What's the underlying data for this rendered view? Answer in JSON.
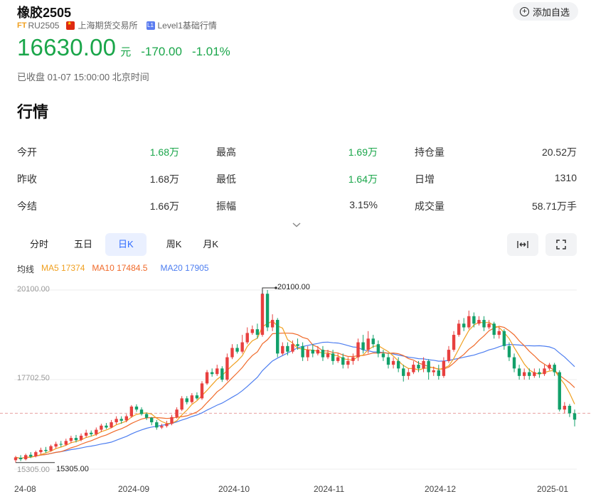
{
  "header": {
    "title": "橡胶2505",
    "exchange_tag": "FT",
    "code": "RU2505",
    "exchange": "上海期货交易所",
    "level_badge": "L1",
    "level": "Level1基础行情",
    "watch_label": "添加自选"
  },
  "quote": {
    "price": "16630.00",
    "unit": "元",
    "change": "-170.00",
    "change_pct": "-1.01%",
    "status": "已收盘 01-07 15:00:00 北京时间",
    "color": "#1aa64a"
  },
  "section_title": "行情",
  "stats": [
    [
      {
        "label": "今开",
        "value": "1.68万",
        "color": "green"
      },
      {
        "label": "最高",
        "value": "1.69万",
        "color": "green"
      },
      {
        "label": "持仓量",
        "value": "20.52万",
        "color": "dark"
      }
    ],
    [
      {
        "label": "昨收",
        "value": "1.68万",
        "color": "dark"
      },
      {
        "label": "最低",
        "value": "1.64万",
        "color": "green"
      },
      {
        "label": "日增",
        "value": "1310",
        "color": "dark"
      }
    ],
    [
      {
        "label": "今结",
        "value": "1.66万",
        "color": "dark"
      },
      {
        "label": "振幅",
        "value": "3.15%",
        "color": "dark"
      },
      {
        "label": "成交量",
        "value": "58.71万手",
        "color": "dark"
      }
    ]
  ],
  "expand_icon": "chevron-down-icon",
  "tabs": [
    {
      "label": "分时",
      "active": false
    },
    {
      "label": "五日",
      "active": false
    },
    {
      "label": "日K",
      "active": true
    },
    {
      "label": "周K",
      "active": false
    },
    {
      "label": "月K",
      "active": false
    }
  ],
  "tools": {
    "fit_icon": "fit-width-icon",
    "fullscreen_icon": "fullscreen-icon"
  },
  "legend": {
    "label": "均线",
    "ma5": "MA5 17374",
    "ma10": "MA10 17484.5",
    "ma20": "MA20 17905"
  },
  "colors": {
    "up": "#e8403f",
    "down": "#12a06a",
    "ma5": "#f0a020",
    "ma10": "#f06a2a",
    "ma20": "#4d7ef0",
    "ref": "#e8a0a0"
  },
  "chart_data": {
    "type": "candlestick",
    "y_ticks": [
      "20100.00",
      "17702.50",
      "15305.00"
    ],
    "x_ticks": [
      "24-08",
      "2024-09",
      "2024-10",
      "2024-11",
      "2024-12",
      "2025-01"
    ],
    "ylim": [
      15305,
      20100
    ],
    "max_label": "20100.00",
    "min_label": "15305.00",
    "reference_price": 16800,
    "candles": [
      [
        15545,
        15620,
        15480,
        15660
      ],
      [
        15610,
        15570,
        15520,
        15680
      ],
      [
        15570,
        15680,
        15540,
        15720
      ],
      [
        15690,
        15640,
        15600,
        15760
      ],
      [
        15650,
        15760,
        15620,
        15800
      ],
      [
        15760,
        15820,
        15700,
        15880
      ],
      [
        15820,
        15790,
        15740,
        15900
      ],
      [
        15800,
        15920,
        15770,
        15960
      ],
      [
        15910,
        15980,
        15860,
        16040
      ],
      [
        15980,
        15960,
        15900,
        16060
      ],
      [
        15960,
        16060,
        15930,
        16120
      ],
      [
        16060,
        16140,
        16000,
        16200
      ],
      [
        16140,
        16080,
        16020,
        16220
      ],
      [
        16090,
        16200,
        16050,
        16260
      ],
      [
        16200,
        16280,
        16150,
        16360
      ],
      [
        16280,
        16240,
        16180,
        16340
      ],
      [
        16240,
        16360,
        16200,
        16420
      ],
      [
        16360,
        16470,
        16300,
        16520
      ],
      [
        16470,
        16420,
        16380,
        16540
      ],
      [
        16420,
        16560,
        16400,
        16620
      ],
      [
        16560,
        16650,
        16500,
        16720
      ],
      [
        16650,
        16600,
        16520,
        16720
      ],
      [
        16610,
        16720,
        16560,
        16780
      ],
      [
        16720,
        16980,
        16680,
        17020
      ],
      [
        16980,
        16900,
        16840,
        17040
      ],
      [
        16900,
        16780,
        16740,
        16960
      ],
      [
        16780,
        16680,
        16620,
        16820
      ],
      [
        16680,
        16560,
        16480,
        16700
      ],
      [
        16560,
        16420,
        16360,
        16620
      ],
      [
        16420,
        16460,
        16380,
        16520
      ],
      [
        16460,
        16520,
        16420,
        16600
      ],
      [
        16520,
        16700,
        16480,
        16760
      ],
      [
        16700,
        16900,
        16660,
        16960
      ],
      [
        16900,
        17200,
        16860,
        17260
      ],
      [
        17200,
        17100,
        17040,
        17260
      ],
      [
        17100,
        17280,
        17060,
        17340
      ],
      [
        17280,
        17200,
        17160,
        17360
      ],
      [
        17200,
        17600,
        17160,
        17660
      ],
      [
        17600,
        17900,
        17560,
        17960
      ],
      [
        17900,
        17850,
        17780,
        18000
      ],
      [
        17850,
        18000,
        17800,
        18100
      ],
      [
        18000,
        17700,
        17640,
        18060
      ],
      [
        17700,
        18300,
        17660,
        18400
      ],
      [
        18300,
        18550,
        18250,
        18650
      ],
      [
        18550,
        18450,
        18400,
        18650
      ],
      [
        18450,
        18700,
        18400,
        18900
      ],
      [
        18700,
        18950,
        18650,
        19100
      ],
      [
        18950,
        19050,
        18900,
        19150
      ],
      [
        19050,
        18900,
        18800,
        19200
      ],
      [
        18900,
        20000,
        18850,
        20100
      ],
      [
        20000,
        19100,
        19000,
        20100
      ],
      [
        19100,
        19300,
        19000,
        19450
      ],
      [
        19300,
        18400,
        18300,
        19350
      ],
      [
        18400,
        18600,
        18350,
        18700
      ],
      [
        18600,
        18450,
        18350,
        18700
      ],
      [
        18450,
        18650,
        18400,
        18750
      ],
      [
        18650,
        18600,
        18500,
        18800
      ],
      [
        18600,
        18300,
        18200,
        18700
      ],
      [
        18300,
        18500,
        18200,
        18600
      ],
      [
        18500,
        18400,
        18300,
        18650
      ],
      [
        18400,
        18500,
        18350,
        18600
      ],
      [
        18500,
        18300,
        18200,
        18600
      ],
      [
        18300,
        18400,
        18250,
        18500
      ],
      [
        18400,
        18200,
        18100,
        18500
      ],
      [
        18200,
        18300,
        18150,
        18400
      ],
      [
        18300,
        18100,
        18000,
        18400
      ],
      [
        18100,
        18200,
        18000,
        18300
      ],
      [
        18200,
        18300,
        18100,
        18400
      ],
      [
        18300,
        18700,
        18200,
        18800
      ],
      [
        18700,
        18500,
        18400,
        18900
      ],
      [
        18500,
        18800,
        18400,
        19000
      ],
      [
        18800,
        18650,
        18550,
        18900
      ],
      [
        18650,
        18400,
        18300,
        18750
      ],
      [
        18400,
        18300,
        18200,
        18500
      ],
      [
        18300,
        18100,
        18000,
        18400
      ],
      [
        18100,
        18200,
        18000,
        18300
      ],
      [
        18200,
        18000,
        17900,
        18300
      ],
      [
        18000,
        17800,
        17650,
        18100
      ],
      [
        17800,
        17900,
        17700,
        18000
      ],
      [
        17900,
        18100,
        17850,
        18200
      ],
      [
        18100,
        18000,
        17900,
        18200
      ],
      [
        18000,
        18200,
        17900,
        18300
      ],
      [
        18200,
        17900,
        17700,
        18250
      ],
      [
        17900,
        17950,
        17800,
        18050
      ],
      [
        17950,
        17800,
        17700,
        18100
      ],
      [
        17800,
        18200,
        17750,
        18300
      ],
      [
        18200,
        18500,
        18150,
        18600
      ],
      [
        18500,
        18900,
        18450,
        19000
      ],
      [
        18900,
        19200,
        18850,
        19300
      ],
      [
        19200,
        19100,
        19000,
        19350
      ],
      [
        19100,
        19400,
        19050,
        19550
      ],
      [
        19400,
        19200,
        19100,
        19500
      ],
      [
        19200,
        19300,
        19150,
        19400
      ],
      [
        19300,
        19100,
        19000,
        19400
      ],
      [
        19100,
        19200,
        19050,
        19300
      ],
      [
        19200,
        18900,
        18800,
        19250
      ],
      [
        18900,
        19000,
        18800,
        19100
      ],
      [
        19000,
        18600,
        18500,
        19050
      ],
      [
        18600,
        18300,
        18200,
        18700
      ],
      [
        18300,
        18000,
        17900,
        18400
      ],
      [
        18000,
        17800,
        17700,
        18100
      ],
      [
        17800,
        17900,
        17700,
        18000
      ],
      [
        17900,
        17800,
        17700,
        18000
      ],
      [
        17800,
        17900,
        17750,
        18000
      ],
      [
        17900,
        17850,
        17750,
        18000
      ],
      [
        17850,
        18000,
        17800,
        18100
      ],
      [
        18000,
        18100,
        17950,
        18150
      ],
      [
        18100,
        17900,
        17800,
        18150
      ],
      [
        17900,
        16900,
        16850,
        17950
      ],
      [
        16900,
        17000,
        16800,
        17100
      ],
      [
        17000,
        16800,
        16700,
        17050
      ],
      [
        16800,
        16630,
        16450,
        16900
      ]
    ]
  }
}
